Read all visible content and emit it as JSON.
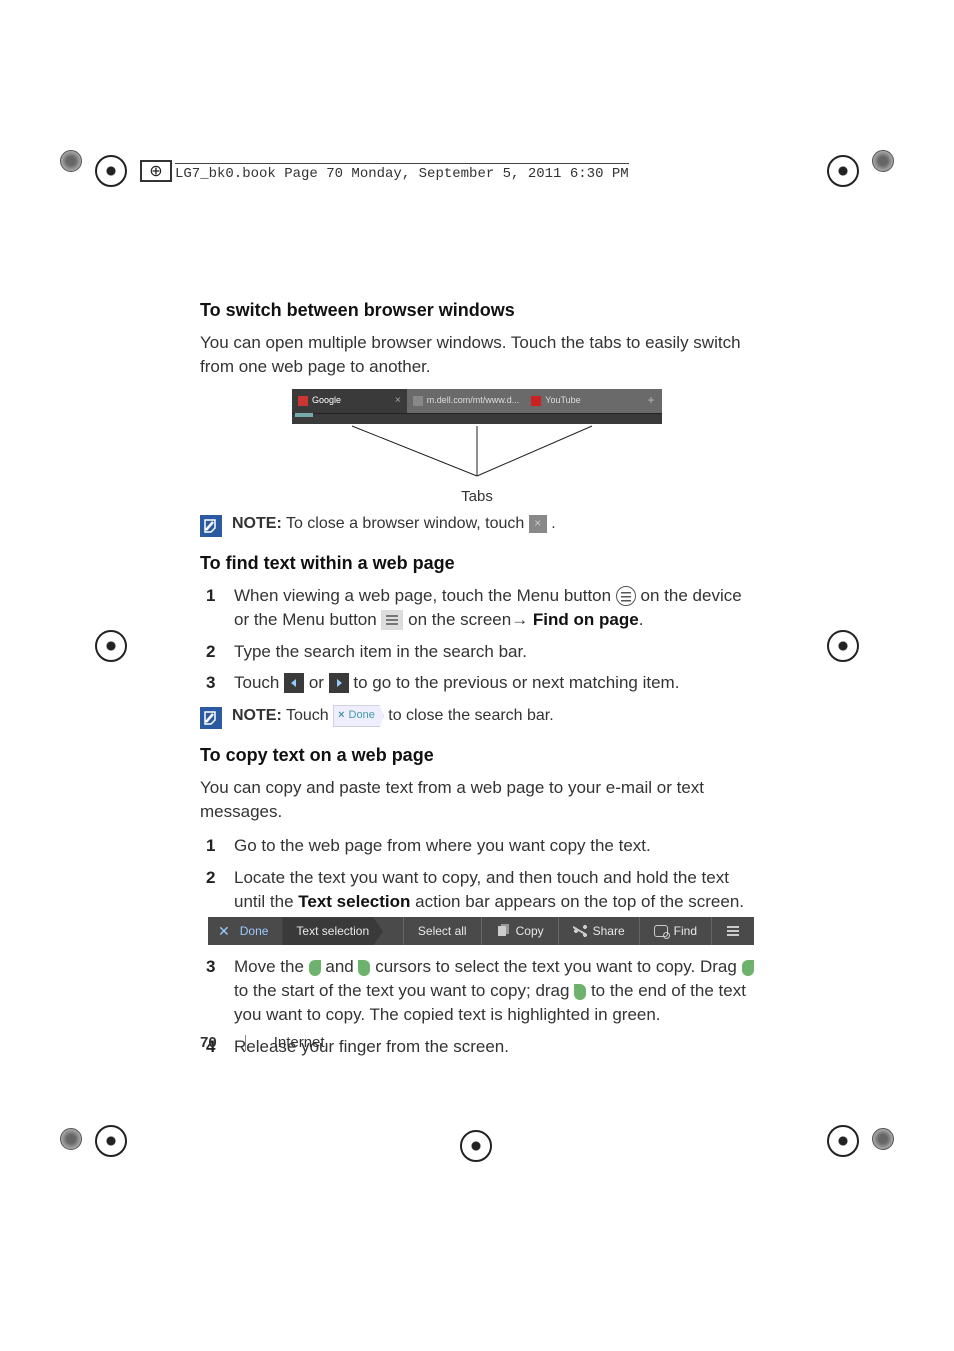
{
  "header_tag": "LG7_bk0.book  Page 70  Monday, September 5, 2011  6:30 PM",
  "section1": {
    "heading": "To switch between browser windows",
    "intro": "You can open multiple browser windows. Touch the tabs to easily switch from one web page to another.",
    "caption": "Tabs",
    "tabs": {
      "t1": "Google",
      "t2": "m.dell.com/mt/www.d...",
      "t3": "YouTube",
      "add": "+"
    },
    "note_label": "NOTE:",
    "note_a": "To close a browser window, touch ",
    "note_b": "."
  },
  "section2": {
    "heading": "To find text within a web page",
    "s1a": "When viewing a web page, touch the Menu button ",
    "s1b": " on the device or the Menu button ",
    "s1c": " on the screen",
    "s1arrow": "→ ",
    "s1d": "Find on page",
    "s1e": ".",
    "s2": "Type the search item in the search bar.",
    "s3a": "Touch ",
    "s3b": " or ",
    "s3c": " to go to the previous or next matching item.",
    "note_label": "NOTE:",
    "note_a": "Touch ",
    "note_chip": "Done",
    "note_b": " to close the search bar."
  },
  "section3": {
    "heading": "To copy text on a web page",
    "intro": "You can copy and paste text from a web page to your e-mail or text messages.",
    "s1": "Go to the web page from where you want copy the text.",
    "s2a": "Locate the text you want to copy, and then touch and hold the text until the ",
    "s2b": "Text selection",
    "s2c": " action bar appears on the top of the screen.",
    "bar": {
      "done": "Done",
      "title": "Text selection",
      "selectall": "Select all",
      "copy": "Copy",
      "share": "Share",
      "find": "Find"
    },
    "s3a": "Move the ",
    "s3b": " and ",
    "s3c": " cursors to select the text you want to copy. Drag ",
    "s3d": " to the start of the text you want to copy; drag ",
    "s3e": " to the end of the text you want to copy. The copied text is highlighted in green.",
    "s4": "Release your finger from the screen."
  },
  "footer": {
    "page": "70",
    "chapter": "Internet"
  }
}
